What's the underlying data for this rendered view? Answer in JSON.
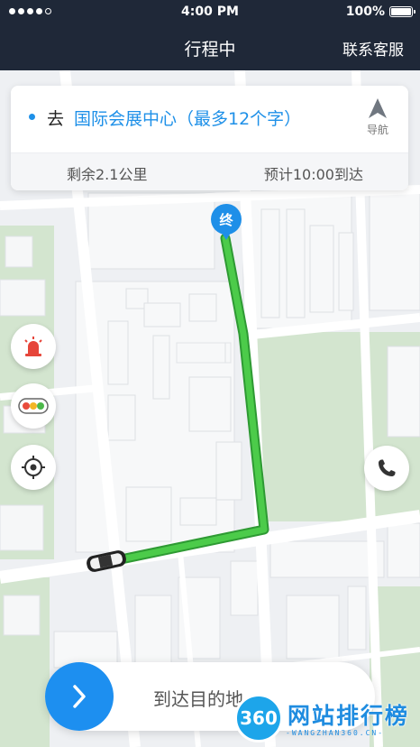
{
  "status_bar": {
    "time": "4:00 PM",
    "battery": "100%",
    "signal_dots": 5,
    "signal_filled": 4
  },
  "header": {
    "title": "行程中",
    "contact_service": "联系客服"
  },
  "destination_card": {
    "prefix": "去",
    "destination": "国际会展中心（最多12个字）",
    "navigate_label": "导航",
    "remaining": "剩余2.1公里",
    "eta": "预计10:00到达"
  },
  "map": {
    "end_marker_label": "终",
    "route_color": "#3fc03f",
    "marker_color": "#1e8fe8"
  },
  "controls": {
    "alarm": "alarm-icon",
    "traffic": "traffic-light-icon",
    "locate": "locate-icon",
    "phone": "phone-icon"
  },
  "bottom_bar": {
    "arrive_label": "到达目的地"
  },
  "watermark": {
    "logo_text": "360",
    "text": "网站排行榜",
    "sub": "-WANGZHAN360.CN-"
  },
  "colors": {
    "header_bg": "#1f2838",
    "accent": "#1e90e8",
    "knob": "#1d8ff0"
  }
}
